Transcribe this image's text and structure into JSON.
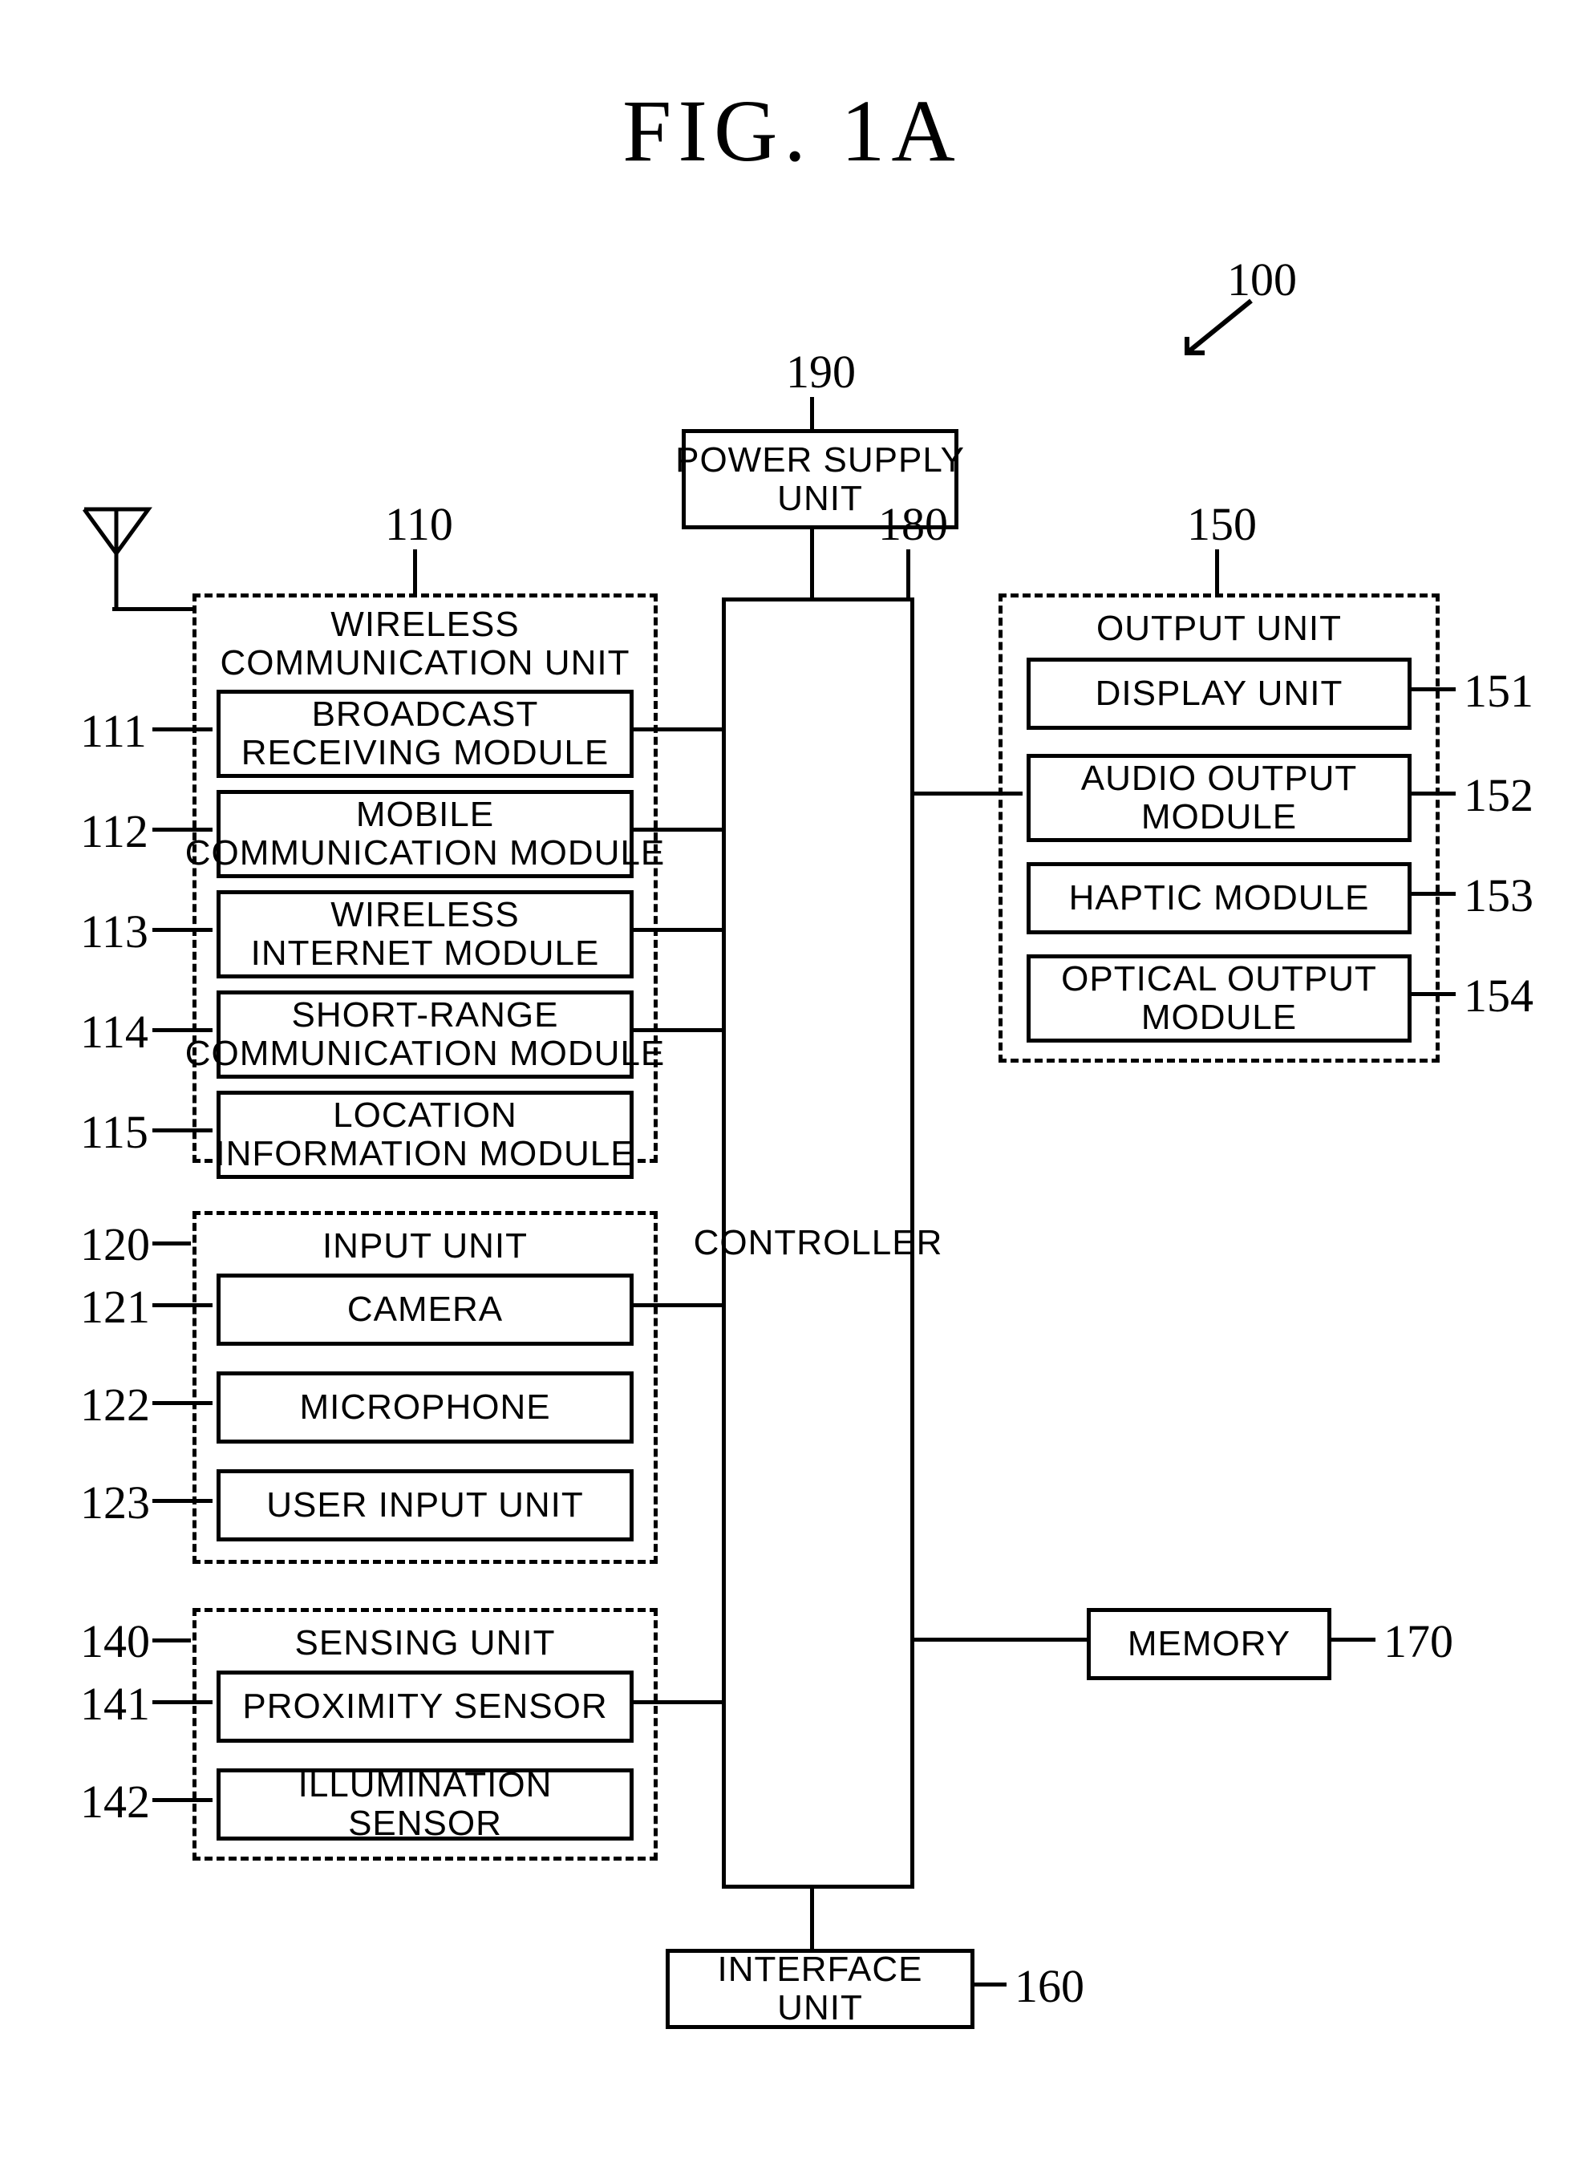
{
  "figure_title": "FIG. 1A",
  "refs": {
    "r100": "100",
    "r190": "190",
    "r180": "180",
    "r110": "110",
    "r111": "111",
    "r112": "112",
    "r113": "113",
    "r114": "114",
    "r115": "115",
    "r120": "120",
    "r121": "121",
    "r122": "122",
    "r123": "123",
    "r140": "140",
    "r141": "141",
    "r142": "142",
    "r150": "150",
    "r151": "151",
    "r152": "152",
    "r153": "153",
    "r154": "154",
    "r170": "170",
    "r160": "160"
  },
  "labels": {
    "power_supply": "POWER SUPPLY\nUNIT",
    "controller": "CONTROLLER",
    "wireless_unit": "WIRELESS\nCOMMUNICATION UNIT",
    "broadcast": "BROADCAST\nRECEIVING MODULE",
    "mobile_comm": "MOBILE\nCOMMUNICATION MODULE",
    "wifi": "WIRELESS\nINTERNET MODULE",
    "short_range": "SHORT-RANGE\nCOMMUNICATION MODULE",
    "location": "LOCATION\nINFORMATION MODULE",
    "input_unit": "INPUT UNIT",
    "camera": "CAMERA",
    "microphone": "MICROPHONE",
    "user_input": "USER INPUT UNIT",
    "sensing_unit": "SENSING UNIT",
    "proximity": "PROXIMITY SENSOR",
    "illumination": "ILLUMINATION SENSOR",
    "output_unit": "OUTPUT UNIT",
    "display": "DISPLAY UNIT",
    "audio": "AUDIO OUTPUT\nMODULE",
    "haptic": "HAPTIC MODULE",
    "optical": "OPTICAL OUTPUT\nMODULE",
    "memory": "MEMORY",
    "interface": "INTERFACE UNIT"
  }
}
